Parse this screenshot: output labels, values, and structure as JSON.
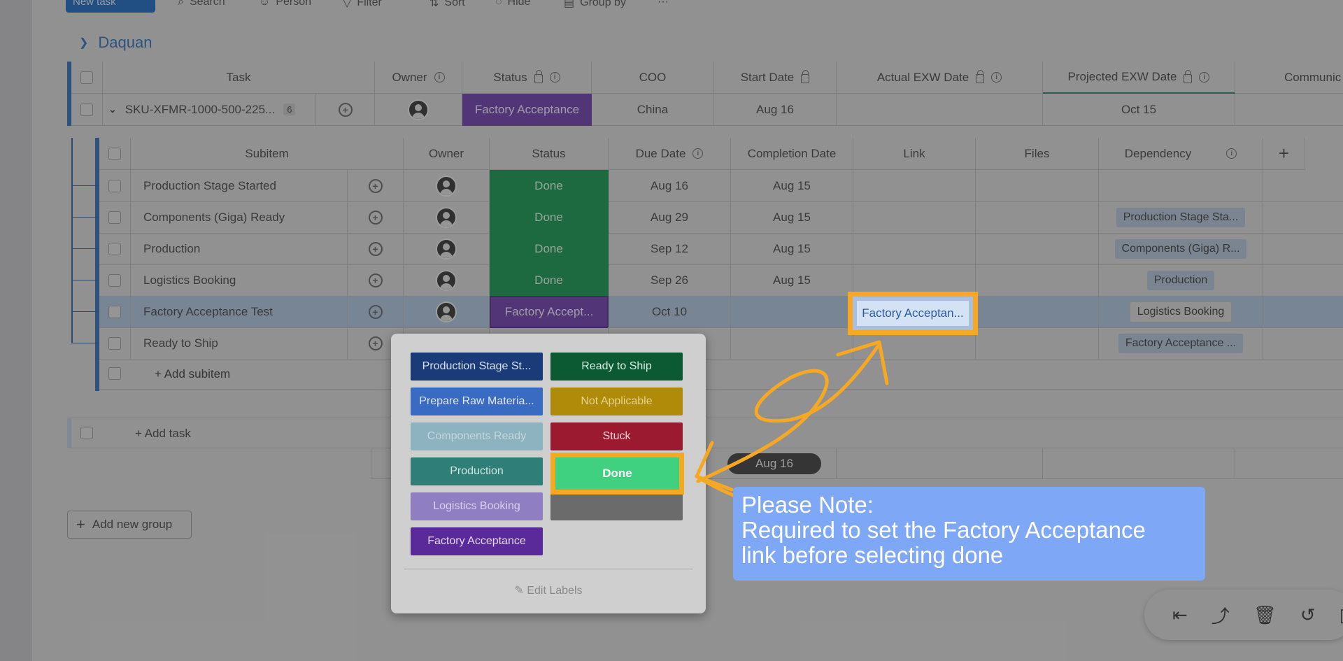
{
  "toolbar": {
    "new_task": "New task",
    "search": "Search",
    "person": "Person",
    "filter": "Filter",
    "sort": "Sort",
    "hide": "Hide",
    "group_by": "Group by",
    "more": "···"
  },
  "group": {
    "title": "Daquan"
  },
  "main_table": {
    "headers": [
      "Task",
      "Owner",
      "Status",
      "COO",
      "Start Date",
      "Actual EXW Date",
      "Projected EXW Date",
      "Communic"
    ],
    "row": {
      "task": "SKU-XFMR-1000-500-225...",
      "subitem_count": "6",
      "status": "Factory Acceptance",
      "coo": "China",
      "start_date": "Aug 16",
      "projected_exw": "Oct 15"
    },
    "add_task": "+ Add task",
    "summary_date": "Aug 16"
  },
  "subitems": {
    "headers": [
      "Subitem",
      "Owner",
      "Status",
      "Due Date",
      "Completion Date",
      "Link",
      "Files",
      "Dependency"
    ],
    "rows": [
      {
        "name": "Production Stage Started",
        "status": "Done",
        "due": "Aug 16",
        "completion": "Aug 15",
        "link": "",
        "dependency": ""
      },
      {
        "name": "Components (Giga) Ready",
        "status": "Done",
        "due": "Aug 29",
        "completion": "Aug 15",
        "link": "",
        "dependency": "Production Stage Sta..."
      },
      {
        "name": "Production",
        "status": "Done",
        "due": "Sep 12",
        "completion": "Aug 15",
        "link": "",
        "dependency": "Components (Giga) R..."
      },
      {
        "name": "Logistics Booking",
        "status": "Done",
        "due": "Sep 26",
        "completion": "Aug 15",
        "link": "",
        "dependency": "Production"
      },
      {
        "name": "Factory Acceptance Test",
        "status": "Factory Accept...",
        "due": "Oct 10",
        "completion": "",
        "link": "Factory Acceptan...",
        "dependency": "Logistics Booking"
      },
      {
        "name": "Ready to Ship",
        "status": "",
        "due": "",
        "completion": "",
        "link": "",
        "dependency": "Factory Acceptance ..."
      }
    ],
    "add_subitem": "+ Add subitem"
  },
  "status_menu": {
    "options": [
      {
        "label": "Production Stage St...",
        "color": "#1b3b78",
        "text": "#d8e0ee"
      },
      {
        "label": "Ready to Ship",
        "color": "#0b5a34",
        "text": "#d9eee2"
      },
      {
        "label": "Prepare Raw Materia...",
        "color": "#3a6bc2",
        "text": "#dde6f6"
      },
      {
        "label": "Not Applicable",
        "color": "#b08a09",
        "text": "#e6d38c"
      },
      {
        "label": "Components Ready",
        "color": "#8eb3c0",
        "text": "#c1d6dd"
      },
      {
        "label": "Stuck",
        "color": "#9c1a30",
        "text": "#f0d5da"
      },
      {
        "label": "Production",
        "color": "#2f7e78",
        "text": "#cde6e3"
      },
      {
        "label": "Done",
        "color": "#3fd17f",
        "text": "#ffffff"
      },
      {
        "label": "Logistics Booking",
        "color": "#8f7fc2",
        "text": "#d8d0ee"
      },
      {
        "label": "",
        "color": "#6b6b6b",
        "text": "#ffffff"
      },
      {
        "label": "Factory Acceptance",
        "color": "#5b2a9a",
        "text": "#e4d9f5"
      }
    ],
    "edit_labels": "Edit Labels"
  },
  "note": {
    "line1": "Please Note:",
    "line2": "Required to set the Factory Acceptance",
    "line3": "link before selecting done"
  },
  "add_group": "Add new group",
  "colors": {
    "highlight": "#f7a823",
    "note_bg": "#7ea8f5",
    "group_accent": "#225aa0"
  }
}
